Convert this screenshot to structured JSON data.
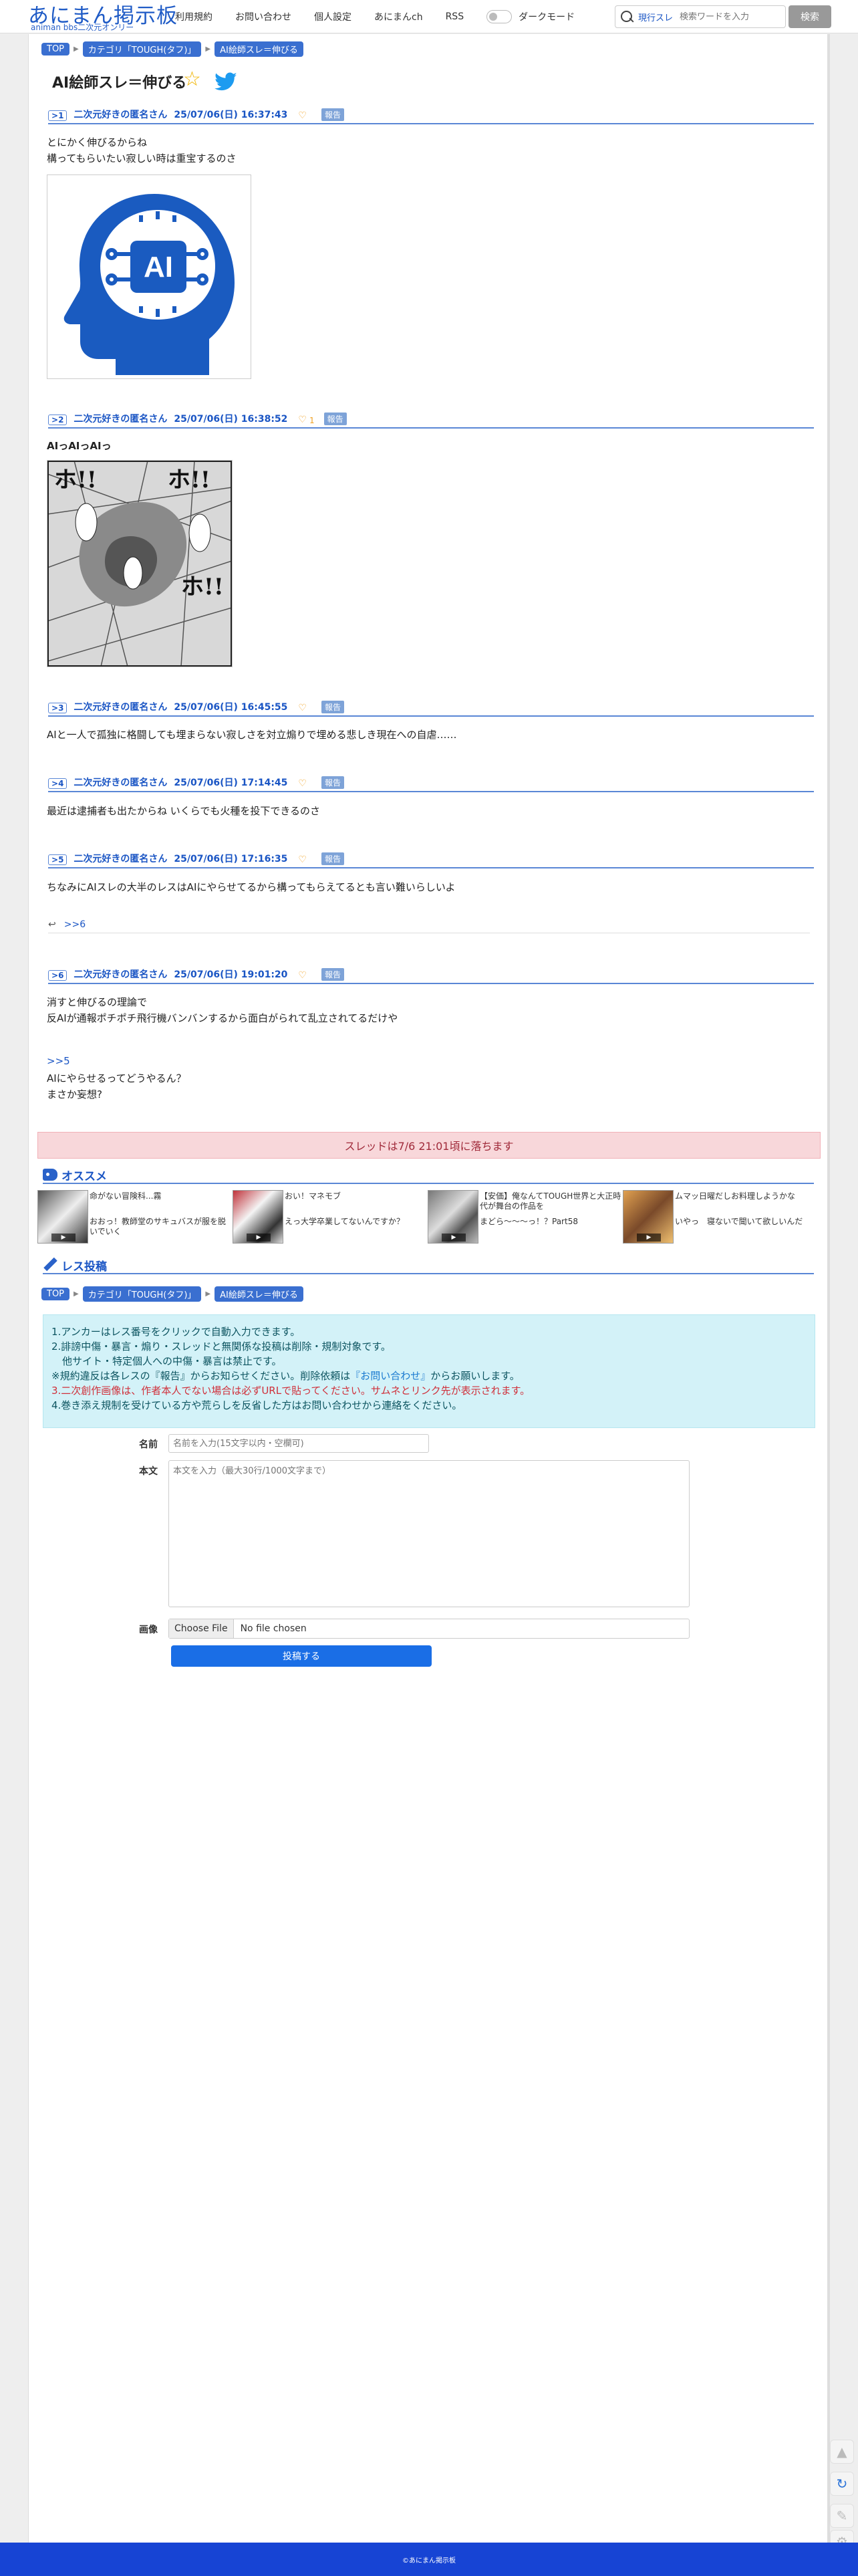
{
  "header": {
    "logo_main": "あにまん掲示板",
    "logo_sub": "animan bbs二次元オンリー",
    "nav": [
      "利用規約",
      "お問い合わせ",
      "個人設定",
      "あにまんch",
      "RSS"
    ],
    "dark_mode_label": "ダークモード",
    "search_scope": "現行スレ",
    "search_placeholder": "検索ワードを入力",
    "search_button": "検索"
  },
  "breadcrumb": [
    "TOP",
    "カテゴリ「TOUGH(タフ)」",
    "AI絵師スレ＝伸びる"
  ],
  "thread_title": "AI絵師スレ＝伸びる",
  "report_label": "報告",
  "posts": [
    {
      "num": "1",
      "name": "二次元好きの匿名さん",
      "date": "25/07/06(日) 16:37:43",
      "likes": "",
      "lines": [
        "とにかく伸びるからね",
        "構ってもらいたい寂しい時は重宝するのさ"
      ],
      "image": "AI"
    },
    {
      "num": "2",
      "name": "二次元好きの匿名さん",
      "date": "25/07/06(日) 16:38:52",
      "likes": "1",
      "lines": [
        "AIっAIっAIっ"
      ],
      "image": "manga"
    },
    {
      "num": "3",
      "name": "二次元好きの匿名さん",
      "date": "25/07/06(日) 16:45:55",
      "likes": "",
      "lines": [
        "AIと一人で孤独に格闘しても埋まらない寂しさを対立煽りで埋める悲しき現在への自虐……"
      ]
    },
    {
      "num": "4",
      "name": "二次元好きの匿名さん",
      "date": "25/07/06(日) 17:14:45",
      "likes": "",
      "lines": [
        "最近は逮捕者も出たからね いくらでも火種を投下できるのさ"
      ]
    },
    {
      "num": "5",
      "name": "二次元好きの匿名さん",
      "date": "25/07/06(日) 17:16:35",
      "likes": "",
      "lines": [
        "ちなみにAIスレの大半のレスはAIにやらせてるから構ってもらえてるとも言い難いらしいよ"
      ],
      "reply": ">>6"
    },
    {
      "num": "6",
      "name": "二次元好きの匿名さん",
      "date": "25/07/06(日) 19:01:20",
      "likes": "",
      "lines": [
        "消すと伸びるの理論で",
        "反AIが通報ポチポチ飛行機バンバンするから面白がられて乱立されてるだけや"
      ],
      "anchor": ">>5",
      "lines2": [
        "AIにやらせるってどうやるん？",
        "まさか妄想?"
      ]
    }
  ],
  "fall_notice": "スレッドは7/6 21:01頃に落ちます",
  "recommend": {
    "title": "オススメ",
    "items": [
      {
        "title": "命がない冒険科...霧",
        "sub": "おおっ！教師堂のサキュバスが服を脱いでいく"
      },
      {
        "title": "おい！マネモブ",
        "sub": "えっ大学卒業してないんですか？"
      },
      {
        "title": "【安価】俺なんてTOUGH世界と大正時代が舞台の作品を",
        "sub": "まどら～～～っ！？Part58"
      },
      {
        "title": "ムマッ日曜だしお料理しようかな",
        "sub": "いやっ　寝ないで聞いて欲しいんだ"
      }
    ]
  },
  "post_form": {
    "title": "レス投稿",
    "rules": [
      "1.アンカーはレス番号をクリックで自動入力できます。",
      "2.誹謗中傷・暴言・煽り・スレッドと無関係な投稿は削除・規制対象です。",
      "他サイト・特定個人への中傷・暴言は禁止です。",
      "※規約違反は各レスの『報告』からお知らせください。削除依頼は",
      "『お問い合わせ』",
      "からお願いします。",
      "3.二次創作画像は、作者本人でない場合は必ずURLで貼ってください。サムネとリンク先が表示されます。",
      "4.巻き添え規制を受けている方や荒らしを反省した方はお問い合わせから連絡をください。"
    ],
    "name_label": "名前",
    "name_placeholder": "名前を入力(15文字以内・空欄可)",
    "body_label": "本文",
    "body_placeholder": "本文を入力（最大30行/1000文字まで）",
    "image_label": "画像",
    "file_button": "Choose File",
    "file_status": "No file chosen",
    "submit": "投稿する"
  },
  "footer": "©あにまん掲示板",
  "colors": {
    "brand": "#1f5bc6",
    "footer": "#1744d4",
    "info_bg": "#d3f2f8",
    "notice_bg": "#f8d7da"
  }
}
